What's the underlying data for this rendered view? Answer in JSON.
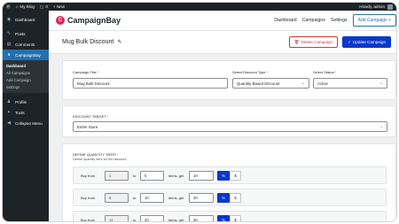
{
  "admin_bar": {
    "site_name": "My Blog",
    "comments_count": "0",
    "new_label": "+ New",
    "greeting": "Howdy, admin"
  },
  "sidebar": {
    "items": [
      {
        "label": "Dashboard",
        "icon": "dashboard-icon",
        "glyph": "◉"
      },
      {
        "label": "Posts",
        "icon": "pin-icon",
        "glyph": "✎"
      },
      {
        "label": "Comments",
        "icon": "comment-icon",
        "glyph": "▤"
      },
      {
        "label": "CampaignBay",
        "icon": "campaignbay-icon",
        "glyph": "●"
      }
    ],
    "submenu": [
      "Dashboard",
      "All Campaigns",
      "Add Campaign",
      "Settings"
    ],
    "lower_items": [
      {
        "label": "Profile",
        "icon": "user-icon",
        "glyph": "♟"
      },
      {
        "label": "Tools",
        "icon": "wrench-icon",
        "glyph": "✦"
      },
      {
        "label": "Collapse Menu",
        "icon": "collapse-icon",
        "glyph": "◀"
      }
    ]
  },
  "plugin_header": {
    "brand": "CampaignBay",
    "nav": [
      "Dashboard",
      "Campaigns",
      "Settings"
    ],
    "add_button": "Add Campaign +"
  },
  "campaign": {
    "title": "Mug Bulk Discount",
    "delete_label": "Delete Campaign",
    "update_label": "Update Campaign"
  },
  "form": {
    "campaign_title_label": "Campaign Title",
    "campaign_title_value": "Mug Bulk Discount",
    "discount_type_label": "Select Discount Type",
    "discount_type_value": "Quantity Based Discount",
    "status_label": "Select Status",
    "status_value": "Active",
    "target_label": "DISCOUNT TARGET",
    "target_value": "Entire Store",
    "tiers_label": "DEFINE QUANTITY TIERS",
    "tiers_hint": "Define quantity tiers for the discount",
    "tiers": [
      {
        "buy_from_label": "Buy from",
        "from": "1",
        "to_label": "to",
        "to": "5",
        "get_label": "items, get",
        "value": "10",
        "pct": "%",
        "dol": "$"
      },
      {
        "buy_from_label": "Buy from",
        "from": "6",
        "to_label": "to",
        "to": "10",
        "get_label": "items, get",
        "value": "20",
        "pct": "%",
        "dol": "$"
      },
      {
        "buy_from_label": "Buy from",
        "from": "11",
        "to_label": "to",
        "to": "20",
        "get_label": "items, get",
        "value": "30",
        "pct": "%",
        "dol": "$"
      }
    ]
  },
  "colors": {
    "wp_dark": "#1d2327",
    "wp_blue": "#2271b1",
    "primary": "#0a38c8",
    "danger": "#d63638",
    "brand": "#e0245e"
  }
}
